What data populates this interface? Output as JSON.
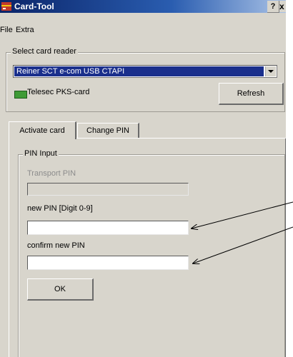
{
  "window": {
    "title": "Card-Tool",
    "help_button": "?",
    "close_button": "x"
  },
  "menu": {
    "items": [
      "File",
      "Extra"
    ]
  },
  "reader_group": {
    "legend": "Select card reader",
    "selected_reader": "Reiner SCT e-com USB CTAPI",
    "card_name": "Telesec PKS-card",
    "refresh_label": "Refresh"
  },
  "tabs": [
    {
      "label": "Activate card",
      "active": true
    },
    {
      "label": "Change PIN",
      "active": false
    }
  ],
  "pin_input": {
    "legend": "PIN Input",
    "transport_pin_label": "Transport PIN",
    "transport_pin_value": "",
    "new_pin_label": "new PIN [Digit 0-9]",
    "new_pin_value": "",
    "confirm_pin_label": "confirm new PIN",
    "confirm_pin_value": "",
    "ok_label": "OK"
  },
  "colors": {
    "titlebar_start": "#0a2468",
    "selection": "#1a2f8c",
    "window_face": "#d8d5cc",
    "card_icon": "#3f9b36"
  }
}
